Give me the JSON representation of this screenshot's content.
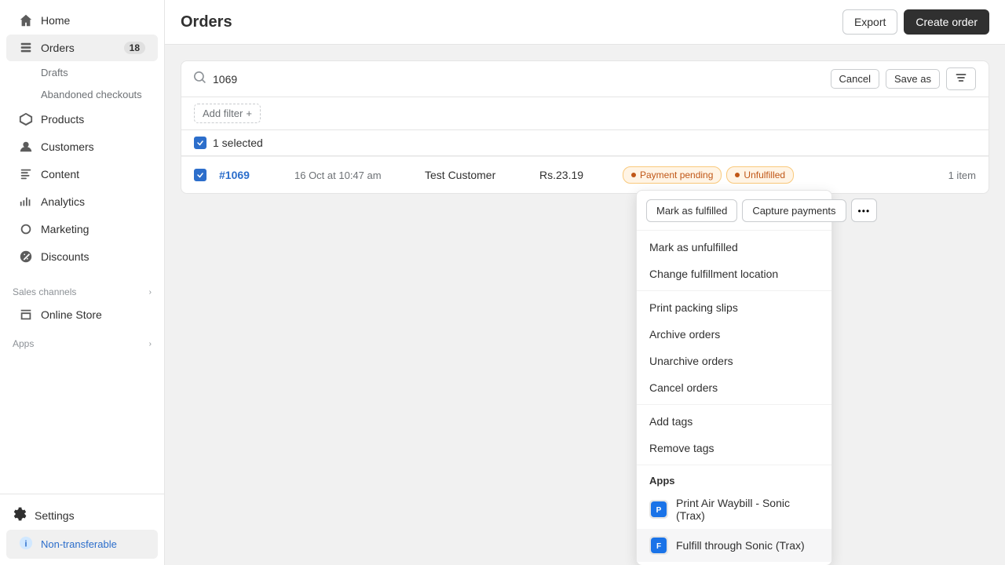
{
  "sidebar": {
    "home": "Home",
    "orders": "Orders",
    "orders_badge": "18",
    "drafts": "Drafts",
    "abandoned_checkouts": "Abandoned checkouts",
    "products": "Products",
    "customers": "Customers",
    "content": "Content",
    "analytics": "Analytics",
    "marketing": "Marketing",
    "discounts": "Discounts",
    "sales_channels": "Sales channels",
    "online_store": "Online Store",
    "apps": "Apps",
    "settings": "Settings",
    "non_transferable": "Non-transferable"
  },
  "header": {
    "title": "Orders",
    "export_btn": "Export",
    "create_order_btn": "Create order"
  },
  "search": {
    "value": "1069",
    "cancel_btn": "Cancel",
    "save_as_btn": "Save as"
  },
  "filter": {
    "add_filter": "Add filter",
    "plus": "+"
  },
  "selection": {
    "count": "1 selected"
  },
  "order_row": {
    "order_number": "#1069",
    "date": "16 Oct at 10:47 am",
    "customer": "Test Customer",
    "amount": "Rs.23.19",
    "payment_status": "Payment pending",
    "fulfillment_status": "Unfulfilled",
    "items": "1 item"
  },
  "action_bar": {
    "mark_fulfilled": "Mark as fulfilled",
    "capture_payments": "Capture payments",
    "more_icon": "•••"
  },
  "dropdown": {
    "items": [
      {
        "label": "Mark as unfulfilled",
        "divider": false
      },
      {
        "label": "Change fulfillment location",
        "divider": true
      },
      {
        "label": "Print packing slips",
        "divider": false
      },
      {
        "label": "Archive orders",
        "divider": false
      },
      {
        "label": "Unarchive orders",
        "divider": false
      },
      {
        "label": "Cancel orders",
        "divider": true
      },
      {
        "label": "Add tags",
        "divider": false
      },
      {
        "label": "Remove tags",
        "divider": true
      }
    ],
    "apps_label": "Apps",
    "app_items": [
      {
        "label": "Print Air Waybill - Sonic (Trax)"
      },
      {
        "label": "Fulfill through Sonic (Trax)"
      }
    ]
  }
}
